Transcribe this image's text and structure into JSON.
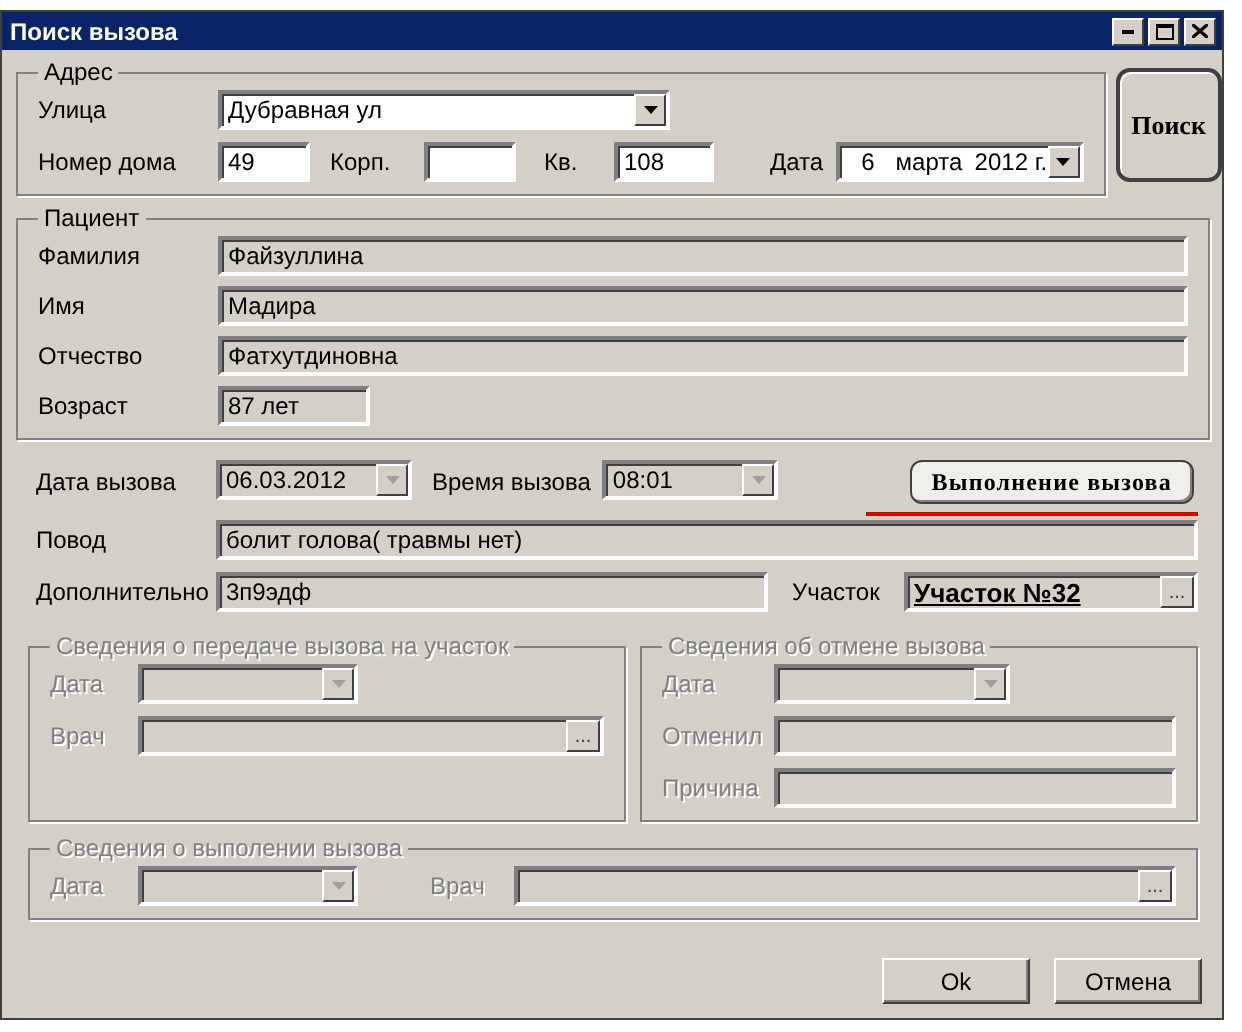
{
  "window": {
    "title": "Поиск вызова"
  },
  "address": {
    "legend": "Адрес",
    "street": {
      "label": "Улица",
      "value": "Дубравная ул"
    },
    "house": {
      "label": "Номер дома",
      "value": "49"
    },
    "building": {
      "label": "Корп."
    },
    "apartment": {
      "label": "Кв.",
      "value": "108"
    },
    "date": {
      "label": "Дата",
      "day": "6",
      "month": "марта",
      "year": "2012 г."
    }
  },
  "search_button": "Поиск",
  "patient": {
    "legend": "Пациент",
    "fields": [
      {
        "label": "Фамилия",
        "value": "Файзуллина",
        "wide": true
      },
      {
        "label": "Имя",
        "value": "Мадира",
        "wide": true
      },
      {
        "label": "Отчество",
        "value": "Фатхутдиновна",
        "wide": true
      },
      {
        "label": "Возраст",
        "value": "87 лет",
        "wide": false
      }
    ]
  },
  "call": {
    "date": {
      "label": "Дата вызова",
      "value": "06.03.2012"
    },
    "time": {
      "label": "Время вызова",
      "value": "08:01"
    },
    "execute_button": {
      "label": "Выполнение вызова",
      "underlined": true
    },
    "reason": {
      "label": "Повод",
      "value": "болит голова( травмы нет)"
    },
    "extra": {
      "label": "Дополнительно",
      "value": "3п9эдф"
    },
    "district": {
      "label": "Участок",
      "value": "Участок №32",
      "browse": "..."
    }
  },
  "transfer": {
    "legend": "Сведения о передаче вызова на участок",
    "disabled": true,
    "date_label": "Дата",
    "doctor_label": "Врач",
    "browse": "..."
  },
  "cancel": {
    "legend": "Сведения об отмене вызова",
    "disabled": true,
    "date_label": "Дата",
    "cancelled_by_label": "Отменил",
    "reason_label": "Причина"
  },
  "completion": {
    "legend": "Сведения о выполении вызова",
    "disabled": true,
    "date_label": "Дата",
    "doctor_label": "Врач",
    "browse": "..."
  },
  "buttons": [
    "Ok",
    "Отмена"
  ]
}
